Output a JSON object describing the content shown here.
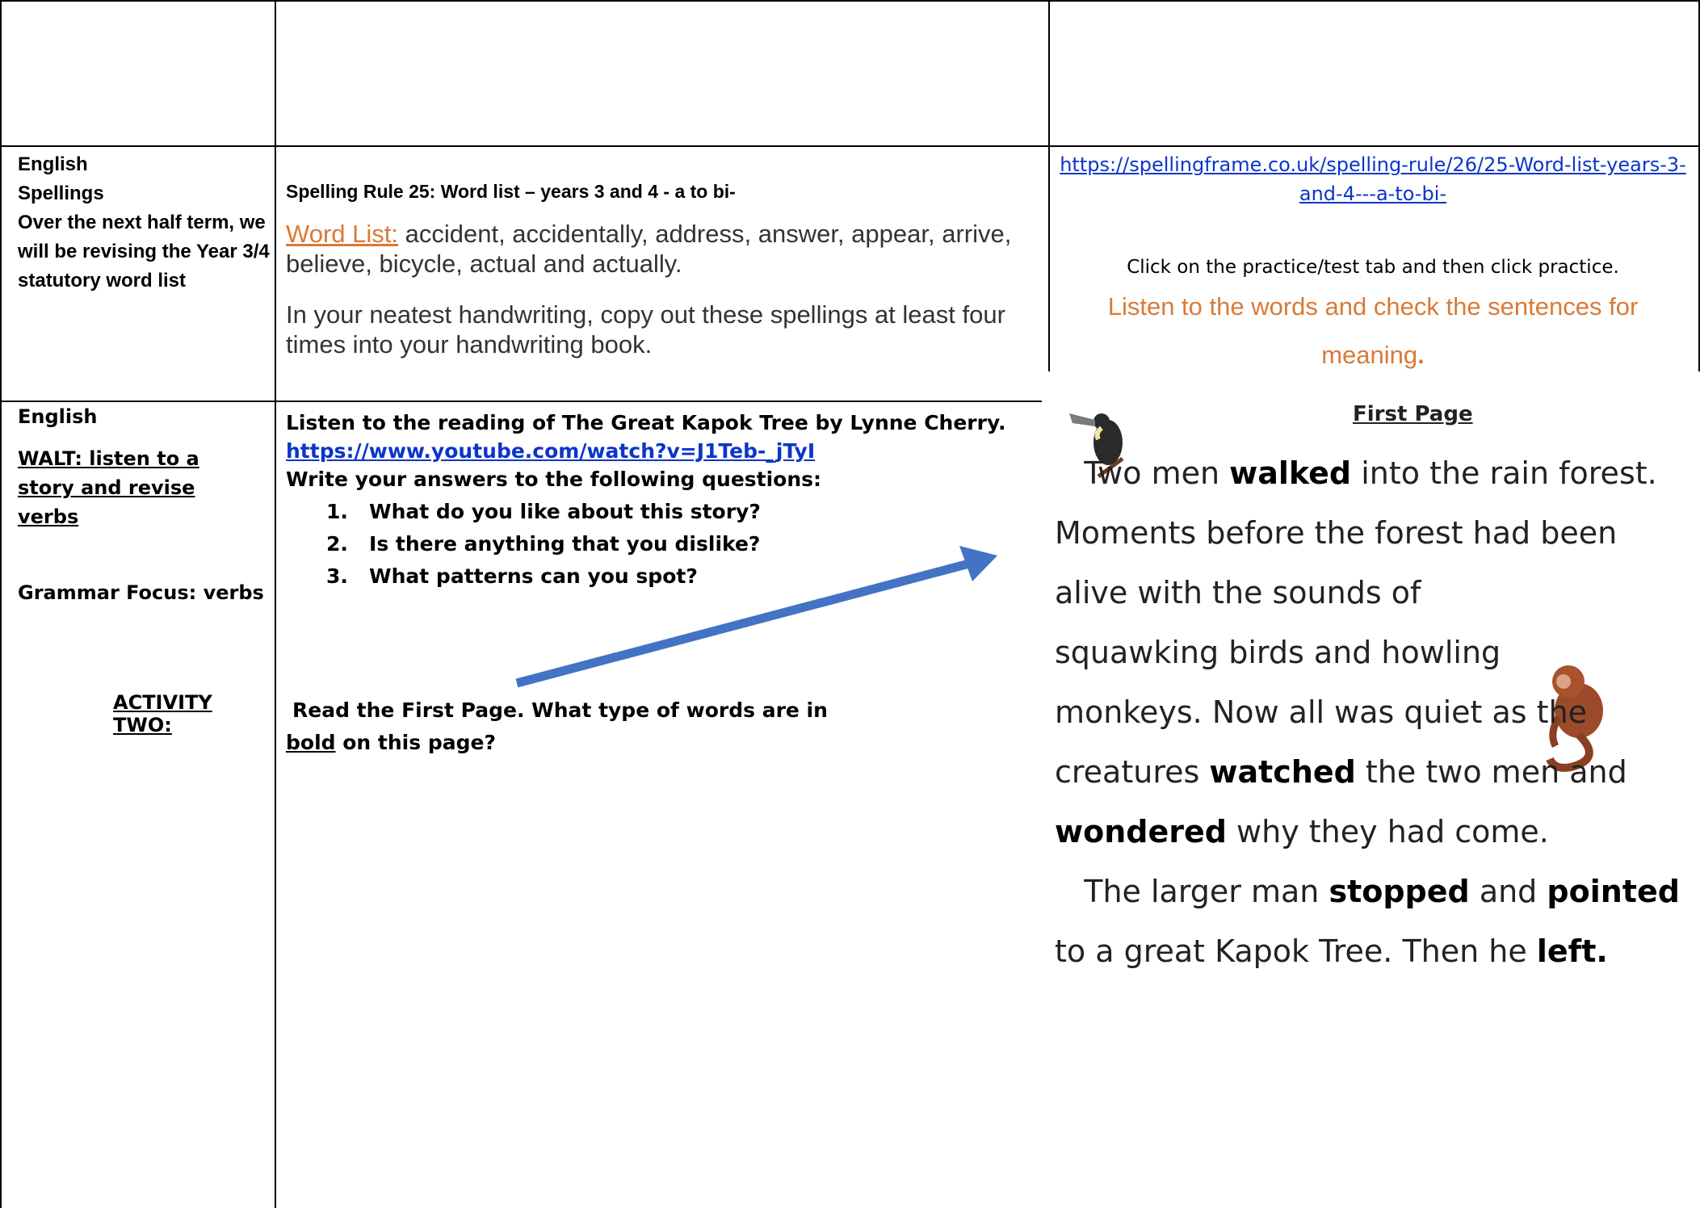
{
  "row2": {
    "subject": "English",
    "topic": "Spellings",
    "intro": "Over the next half term, we will be revising the Year 3/4 statutory word list",
    "spelling_rule": "Spelling Rule 25:  Word list – years 3 and 4 - a to bi-",
    "word_list_label": "Word List:",
    "word_list": "accident, accidentally, address, answer, appear, arrive, believe, bicycle, actual and actually.",
    "handwriting_instruction": "In your neatest handwriting, copy out these spellings at least four times into your handwriting book.",
    "link": "https://spellingframe.co.uk/spelling-rule/26/25-Word-list-years-3-and-4---a-to-bi-",
    "practice_instruction": "Click on the practice/test tab and then click practice.",
    "listen_instruction": "Listen to the words and check the sentences for meaning",
    "listen_punct": "."
  },
  "row3": {
    "subject": "English",
    "walt": "WALT: listen to a story and revise verbs",
    "grammar_focus": "Grammar Focus:  verbs",
    "activity_two": "ACTIVITY TWO:",
    "listen_task": "Listen to the reading of The Great Kapok Tree by Lynne Cherry.",
    "video_link": "https://www.youtube.com/watch?v=J1Teb-_jTyI",
    "write_answers": "Write your answers to the following questions:",
    "questions": [
      {
        "num": "1.",
        "text": "What do you like about this story?"
      },
      {
        "num": "2.",
        "text": "Is there anything that you dislike?"
      },
      {
        "num": "3.",
        "text": "What patterns can you spot?"
      }
    ],
    "activity_two_task_start": "Read the First Page. What type of words are in",
    "activity_two_task_bold": "bold",
    "activity_two_task_end": " on this page?"
  },
  "story": {
    "title": "First Page",
    "lines": [
      [
        "   Two men ",
        "walked",
        " into the rain forest."
      ],
      [
        "Moments before the forest had been"
      ],
      [
        "alive with the sounds of"
      ],
      [
        "squawking birds and howling"
      ],
      [
        "monkeys. Now all was quiet as the"
      ],
      [
        "creatures ",
        "watched",
        " the two men and"
      ],
      [
        "wondered",
        " why they had come."
      ],
      [
        "   The larger man ",
        "stopped",
        " and ",
        "pointed"
      ],
      [
        "to a great Kapok Tree. Then he ",
        "left."
      ]
    ]
  },
  "colors": {
    "arrow": "#4472c4",
    "link": "#0b35c9",
    "orange": "#d97a36"
  }
}
